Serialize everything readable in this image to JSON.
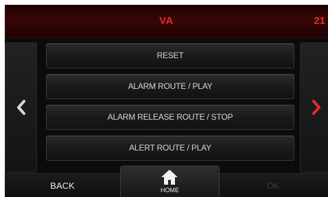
{
  "header": {
    "title": "VA",
    "right_value": "21"
  },
  "navigation": {
    "left_arrow_icon": "chevron-left-icon",
    "right_arrow_icon": "chevron-right-icon",
    "left_arrow_color": "#d8d8d8",
    "right_arrow_color": "#e52a2a"
  },
  "menu": {
    "items": [
      {
        "label": "RESET"
      },
      {
        "label": "ALARM ROUTE / PLAY"
      },
      {
        "label": "ALARM RELEASE ROUTE / STOP"
      },
      {
        "label": "ALERT ROUTE / PLAY"
      }
    ]
  },
  "bottom_bar": {
    "back_label": "BACK",
    "home_label": "HOME",
    "home_icon": "home-icon",
    "ok_label": "OK"
  },
  "colors": {
    "accent": "#e52a2a",
    "background": "#0b0b0b"
  }
}
